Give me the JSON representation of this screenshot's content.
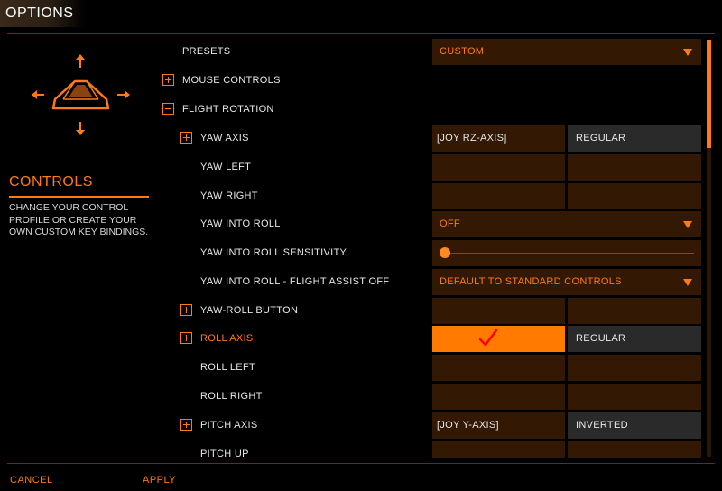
{
  "header": {
    "title": "OPTIONS"
  },
  "sidebar": {
    "heading": "CONTROLS",
    "description": "CHANGE YOUR CONTROL PROFILE OR CREATE YOUR OWN CUSTOM KEY BINDINGS."
  },
  "rows": {
    "presets": {
      "label": "PRESETS",
      "value": "CUSTOM"
    },
    "mouse_controls": {
      "label": "MOUSE CONTROLS"
    },
    "flight_rotation": {
      "label": "FLIGHT ROTATION"
    },
    "yaw_axis": {
      "label": "YAW AXIS",
      "binding": "[JOY RZ-AXIS]",
      "mode": "REGULAR"
    },
    "yaw_left": {
      "label": "YAW LEFT",
      "binding": "",
      "secondary": ""
    },
    "yaw_right": {
      "label": "YAW RIGHT",
      "binding": "",
      "secondary": ""
    },
    "yaw_into_roll": {
      "label": "YAW INTO ROLL",
      "value": "OFF"
    },
    "yaw_into_roll_sensitivity": {
      "label": "YAW INTO ROLL SENSITIVITY",
      "value": 0.0
    },
    "yaw_into_roll_fa_off": {
      "label": "YAW INTO ROLL - FLIGHT ASSIST OFF",
      "value": "DEFAULT TO STANDARD CONTROLS"
    },
    "yaw_roll_button": {
      "label": "YAW-ROLL BUTTON",
      "binding": "",
      "secondary": ""
    },
    "roll_axis": {
      "label": "ROLL AXIS",
      "binding": "",
      "mode": "REGULAR"
    },
    "roll_left": {
      "label": "ROLL LEFT",
      "binding": "",
      "secondary": ""
    },
    "roll_right": {
      "label": "ROLL RIGHT",
      "binding": "",
      "secondary": ""
    },
    "pitch_axis": {
      "label": "PITCH AXIS",
      "binding": "[JOY Y-AXIS]",
      "mode": "INVERTED"
    },
    "pitch_up": {
      "label": "PITCH UP",
      "binding": "",
      "secondary": ""
    }
  },
  "footer": {
    "cancel": "CANCEL",
    "apply": "APPLY"
  },
  "colors": {
    "accent": "#ff7a14",
    "cell_bg": "#331904",
    "mode_bg": "#2a2a2a",
    "selected_bg": "#ff7a00",
    "checkmark": "#ff0000"
  },
  "icons": {
    "ship": "ship-orientation-icon",
    "check": "checkmark-icon"
  }
}
